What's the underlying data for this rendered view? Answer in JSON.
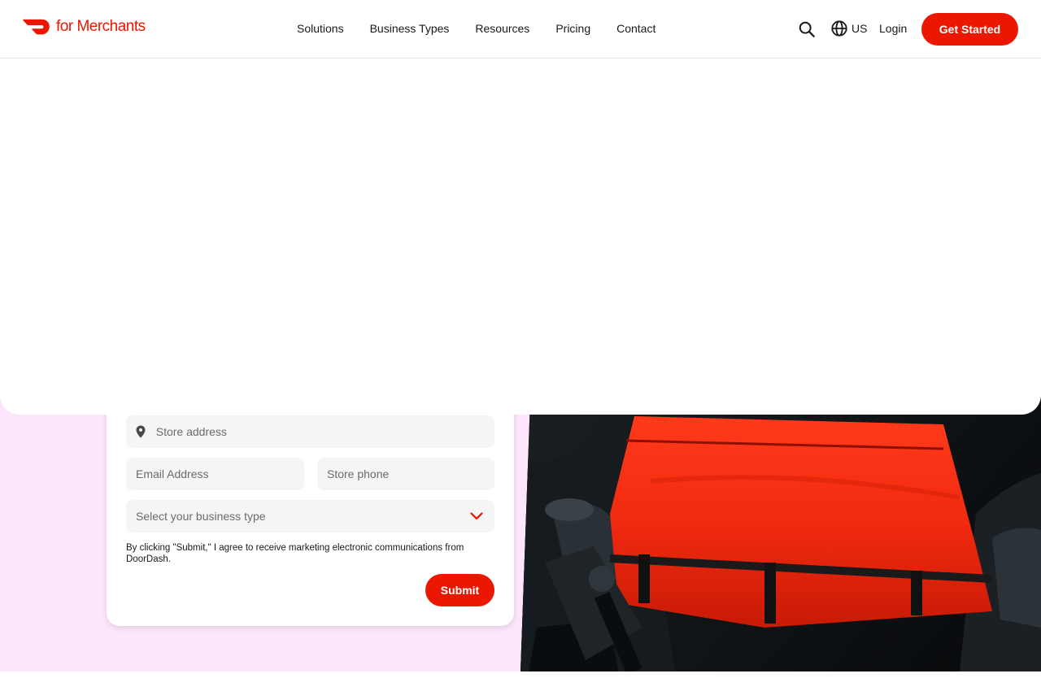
{
  "brand": {
    "logo_text": "for Merchants",
    "accent_color": "#eb1700",
    "hero_background_color": "#fde5fc"
  },
  "header": {
    "nav": [
      {
        "label": "Solutions"
      },
      {
        "label": "Business Types"
      },
      {
        "label": "Resources"
      },
      {
        "label": "Pricing"
      },
      {
        "label": "Contact"
      }
    ],
    "search_icon": "search-icon",
    "locale_icon": "globe-icon",
    "locale_label": "US",
    "login_label": "Login",
    "cta_label": "Get Started"
  },
  "form": {
    "store_address_placeholder": "Store address",
    "email_placeholder": "Email Address",
    "phone_placeholder": "Store phone",
    "business_type_placeholder": "Select your business type",
    "disclaimer": "By clicking \"Submit,\" I agree to receive marketing electronic communications from DoorDash.",
    "submit_label": "Submit"
  },
  "hero_image": {
    "icon": "delivery-bag-photo"
  }
}
